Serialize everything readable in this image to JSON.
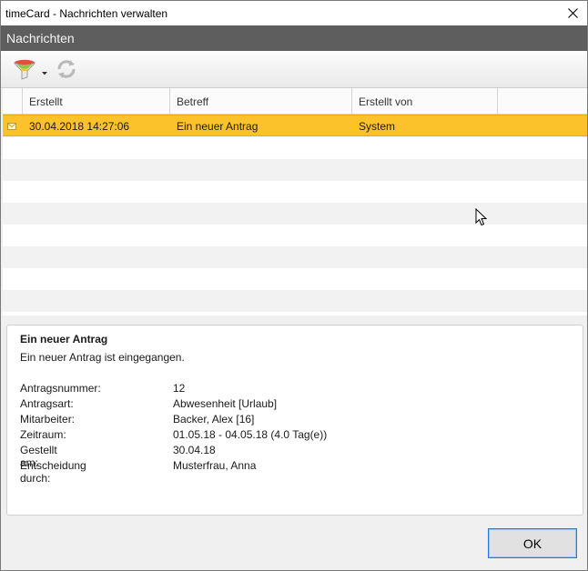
{
  "window": {
    "title": "timeCard - Nachrichten verwalten"
  },
  "header": {
    "title": "Nachrichten"
  },
  "toolbar": {
    "filter_icon": "filter-funnel-icon",
    "refresh_icon": "refresh-icon"
  },
  "grid": {
    "columns": [
      "Erstellt",
      "Betreff",
      "Erstellt von"
    ],
    "rows": [
      {
        "created": "30.04.2018 14:27:06",
        "subject": "Ein neuer Antrag",
        "created_by": "System",
        "selected": true,
        "icon": "envelope-icon"
      }
    ]
  },
  "details": {
    "title": "Ein neuer Antrag",
    "subtitle": "Ein neuer Antrag ist eingegangen.",
    "fields": [
      {
        "label": "Antragsnummer:",
        "value": "12"
      },
      {
        "label": "Antragsart:",
        "value": "Abwesenheit [Urlaub]"
      },
      {
        "label": "Mitarbeiter:",
        "value": "Backer, Alex [16]"
      },
      {
        "label": "Zeitraum:",
        "value": "01.05.18 - 04.05.18 (4.0 Tag(e))"
      },
      {
        "label": "Gestellt am:",
        "value": "30.04.18"
      },
      {
        "label": "Entscheidung durch:",
        "value": "Musterfrau, Anna"
      }
    ]
  },
  "buttons": {
    "ok": "OK"
  },
  "colors": {
    "selection": "#fcc22b",
    "header": "#5e5e5e",
    "focus": "#2a78d6"
  }
}
